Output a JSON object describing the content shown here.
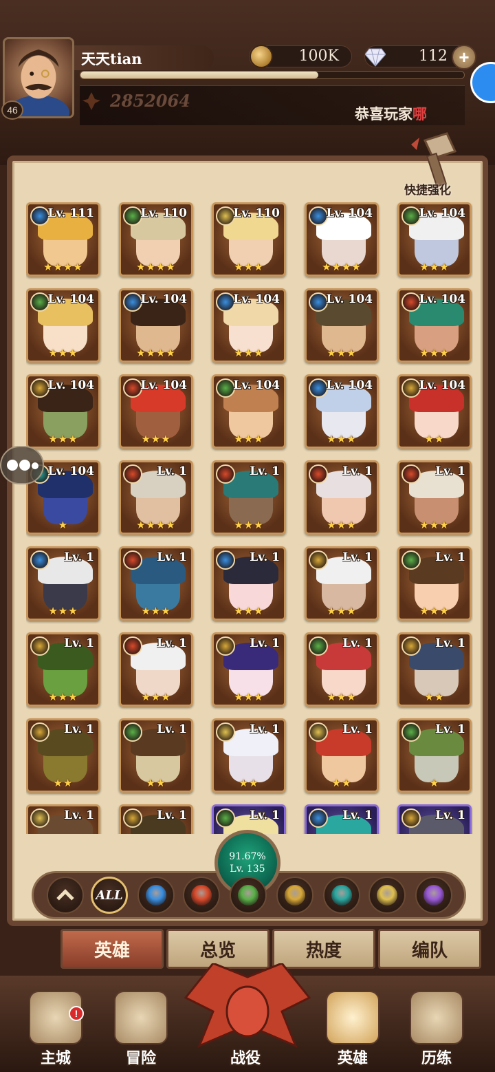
{
  "player": {
    "name": "天天tian",
    "level": "46",
    "power": "2852064",
    "notice_text": "恭喜玩家",
    "notice_tail": "哪"
  },
  "currency": {
    "gold": "100K",
    "gems": "112",
    "plus_label": "+"
  },
  "quick_enhance_label": "快捷强化",
  "colors": {
    "celestial": "#3a8fe0",
    "lightbearer": "#d8a838",
    "wilder": "#5ab048",
    "mauler": "#d84a2a",
    "graveborn": "#9a5ad8",
    "dimensional": "#2aa8a0",
    "hypogean": "#e0c050",
    "brand": "#8a3e2a"
  },
  "heroes": [
    {
      "lv": "Lv. 111",
      "stars": "★★★★",
      "faction": "celestial",
      "skin": "#f0c890",
      "hair": "#e8b040"
    },
    {
      "lv": "Lv. 110",
      "stars": "★★★★",
      "faction": "wilder",
      "skin": "#f0d0b0",
      "hair": "#d8c8a0"
    },
    {
      "lv": "Lv. 110",
      "stars": "★★★",
      "faction": "hypogean",
      "skin": "#f0d0b0",
      "hair": "#f0d890"
    },
    {
      "lv": "Lv. 104",
      "stars": "★★★★",
      "faction": "celestial",
      "skin": "#e8d8d0",
      "hair": "#ffffff"
    },
    {
      "lv": "Lv. 104",
      "stars": "★★★",
      "faction": "wilder",
      "skin": "#c0c8e0",
      "hair": "#f0f0f0"
    },
    {
      "lv": "Lv. 104",
      "stars": "★★★",
      "faction": "wilder",
      "skin": "#f8e0c8",
      "hair": "#e8c060"
    },
    {
      "lv": "Lv. 104",
      "stars": "★★★★",
      "faction": "celestial",
      "skin": "#e0b890",
      "hair": "#3a2418"
    },
    {
      "lv": "Lv. 104",
      "stars": "★★★",
      "faction": "celestial",
      "skin": "#f8e0d0",
      "hair": "#f0d8a8"
    },
    {
      "lv": "Lv. 104",
      "stars": "★★★",
      "faction": "celestial",
      "skin": "#e0b890",
      "hair": "#5a4a30"
    },
    {
      "lv": "Lv. 104",
      "stars": "★★★",
      "faction": "mauler",
      "skin": "#d8a080",
      "hair": "#2a8a70"
    },
    {
      "lv": "Lv. 104",
      "stars": "★★★",
      "faction": "lightbearer",
      "skin": "#8aa060",
      "hair": "#3a2418"
    },
    {
      "lv": "Lv. 104",
      "stars": "★★★",
      "faction": "mauler",
      "skin": "#a06040",
      "hair": "#d83a2a"
    },
    {
      "lv": "Lv. 104",
      "stars": "★★★",
      "faction": "wilder",
      "skin": "#f0c8a0",
      "hair": "#c08050"
    },
    {
      "lv": "Lv. 104",
      "stars": "★★★",
      "faction": "celestial",
      "skin": "#e8e8f0",
      "hair": "#c0d0e8"
    },
    {
      "lv": "Lv. 104",
      "stars": "★★",
      "faction": "lightbearer",
      "skin": "#f8d8c8",
      "hair": "#c8302a"
    },
    {
      "lv": "Lv. 104",
      "stars": "★",
      "faction": "dimensional",
      "skin": "#3a4aa0",
      "hair": "#20306a"
    },
    {
      "lv": "Lv. 1",
      "stars": "★★★★",
      "faction": "mauler",
      "skin": "#e0c0a0",
      "hair": "#d8d0c0"
    },
    {
      "lv": "Lv. 1",
      "stars": "★★★",
      "faction": "mauler",
      "skin": "#8a6a50",
      "hair": "#2a7a78"
    },
    {
      "lv": "Lv. 1",
      "stars": "★★★",
      "faction": "mauler",
      "skin": "#f0c8b0",
      "hair": "#e8e0e0"
    },
    {
      "lv": "Lv. 1",
      "stars": "★★★",
      "faction": "mauler",
      "skin": "#c89070",
      "hair": "#e8e0d0"
    },
    {
      "lv": "Lv. 1",
      "stars": "★★★",
      "faction": "celestial",
      "skin": "#3a3a4a",
      "hair": "#e8e8e8"
    },
    {
      "lv": "Lv. 1",
      "stars": "★★★",
      "faction": "mauler",
      "skin": "#3a7aa0",
      "hair": "#2a5a80"
    },
    {
      "lv": "Lv. 1",
      "stars": "★★★",
      "faction": "celestial",
      "skin": "#f8d8d8",
      "hair": "#2a2a3a"
    },
    {
      "lv": "Lv. 1",
      "stars": "★★★",
      "faction": "lightbearer",
      "skin": "#d8b8a0",
      "hair": "#f0f0f0"
    },
    {
      "lv": "Lv. 1",
      "stars": "★★★",
      "faction": "wilder",
      "skin": "#f8d0b0",
      "hair": "#5a3a20"
    },
    {
      "lv": "Lv. 1",
      "stars": "★★★",
      "faction": "lightbearer",
      "skin": "#6aa040",
      "hair": "#3a5a20"
    },
    {
      "lv": "Lv. 1",
      "stars": "★★★",
      "faction": "mauler",
      "skin": "#f0d8c8",
      "hair": "#f0f0f0"
    },
    {
      "lv": "Lv. 1",
      "stars": "★★★",
      "faction": "lightbearer",
      "skin": "#f8e0e8",
      "hair": "#3a2a7a"
    },
    {
      "lv": "Lv. 1",
      "stars": "★★★",
      "faction": "wilder",
      "skin": "#f8d8c8",
      "hair": "#c83a3a"
    },
    {
      "lv": "Lv. 1",
      "stars": "★★",
      "faction": "lightbearer",
      "skin": "#d8c8b8",
      "hair": "#3a4a6a"
    },
    {
      "lv": "Lv. 1",
      "stars": "★★",
      "faction": "lightbearer",
      "skin": "#8a7a30",
      "hair": "#5a4a20"
    },
    {
      "lv": "Lv. 1",
      "stars": "★★",
      "faction": "wilder",
      "skin": "#d8c8a0",
      "hair": "#5a3a20"
    },
    {
      "lv": "Lv. 1",
      "stars": "★★",
      "faction": "hypogean",
      "skin": "#e8e0e8",
      "hair": "#f0f0f8"
    },
    {
      "lv": "Lv. 1",
      "stars": "★★",
      "faction": "hypogean",
      "skin": "#f0c8a0",
      "hair": "#c83a2a"
    },
    {
      "lv": "Lv. 1",
      "stars": "★",
      "faction": "wilder",
      "skin": "#c8c8b8",
      "hair": "#6a8a40"
    },
    {
      "lv": "Lv. 1",
      "stars": "",
      "faction": "hypogean",
      "skin": "#d8b890",
      "hair": "#6a4a30"
    },
    {
      "lv": "Lv. 1",
      "stars": "",
      "faction": "lightbearer",
      "skin": "#a89070",
      "hair": "#4a3a20"
    },
    {
      "lv": "Lv. 1",
      "stars": "",
      "faction": "wilder",
      "skin": "#e8d0b0",
      "hair": "#f0e0a0",
      "purple": true
    },
    {
      "lv": "Lv. 1",
      "stars": "",
      "faction": "celestial",
      "skin": "#f0d0b0",
      "hair": "#2aa8a0",
      "purple": true
    },
    {
      "lv": "Lv. 1",
      "stars": "",
      "faction": "lightbearer",
      "skin": "#c8c8d8",
      "hair": "#5a5a6a",
      "purple": true
    }
  ],
  "progress": {
    "percent_text": "91.67%",
    "level_text": "Lv. 135"
  },
  "filters": [
    {
      "key": "collapse",
      "label": ""
    },
    {
      "key": "all",
      "label": "ALL"
    },
    {
      "key": "celestial",
      "label": ""
    },
    {
      "key": "mauler",
      "label": ""
    },
    {
      "key": "wilder",
      "label": ""
    },
    {
      "key": "lightbearer",
      "label": ""
    },
    {
      "key": "dimensional",
      "label": ""
    },
    {
      "key": "hypogean",
      "label": ""
    },
    {
      "key": "graveborn",
      "label": ""
    }
  ],
  "tabs": [
    "英雄",
    "总览",
    "热度",
    "编队"
  ],
  "nav": [
    "主城",
    "冒险",
    "战役",
    "英雄",
    "历练"
  ],
  "alert_mark": "!"
}
